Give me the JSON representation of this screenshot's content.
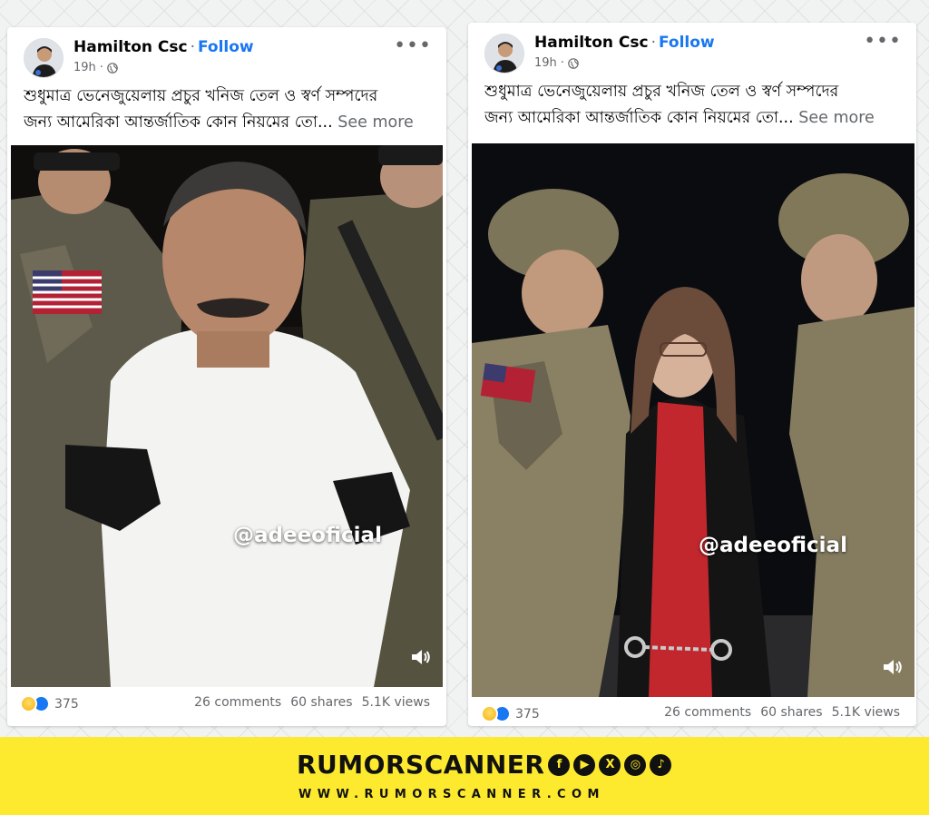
{
  "posts": [
    {
      "author": "Hamilton Csc",
      "follow_label": "Follow",
      "time": "19h",
      "caption_line1": "শুধুমাত্র ভেনেজুয়েলায় প্রচুর খনিজ তেল ও স্বর্ণ সম্পদের",
      "caption_line2": "জন্য আমেরিকা আন্তর্জাতিক কোন নিয়মের তো...",
      "see_more": "See more",
      "watermark": "@adeeoficial",
      "reaction_count": "375",
      "comments": "26 comments",
      "shares": "60 shares",
      "views": "5.1K views"
    },
    {
      "author": "Hamilton Csc",
      "follow_label": "Follow",
      "time": "19h",
      "caption_line1": "শুধুমাত্র ভেনেজুয়েলায় প্রচুর খনিজ তেল ও স্বর্ণ সম্পদের",
      "caption_line2": "জন্য আমেরিকা আন্তর্জাতিক কোন নিয়মের তো...",
      "see_more": "See more",
      "watermark": "@adeeoficial",
      "reaction_count": "375",
      "comments": "26 comments",
      "shares": "60 shares",
      "views": "5.1K views"
    }
  ],
  "banner": {
    "brand": "RUMORSCANNER",
    "website": "WWW.RUMORSCANNER.COM",
    "social_icons": [
      "facebook-icon",
      "youtube-icon",
      "x-icon",
      "instagram-icon",
      "tiktok-icon"
    ]
  },
  "colors": {
    "follow_blue": "#1877f2",
    "banner_yellow": "#fdea2e",
    "meta_gray": "#65676b"
  }
}
